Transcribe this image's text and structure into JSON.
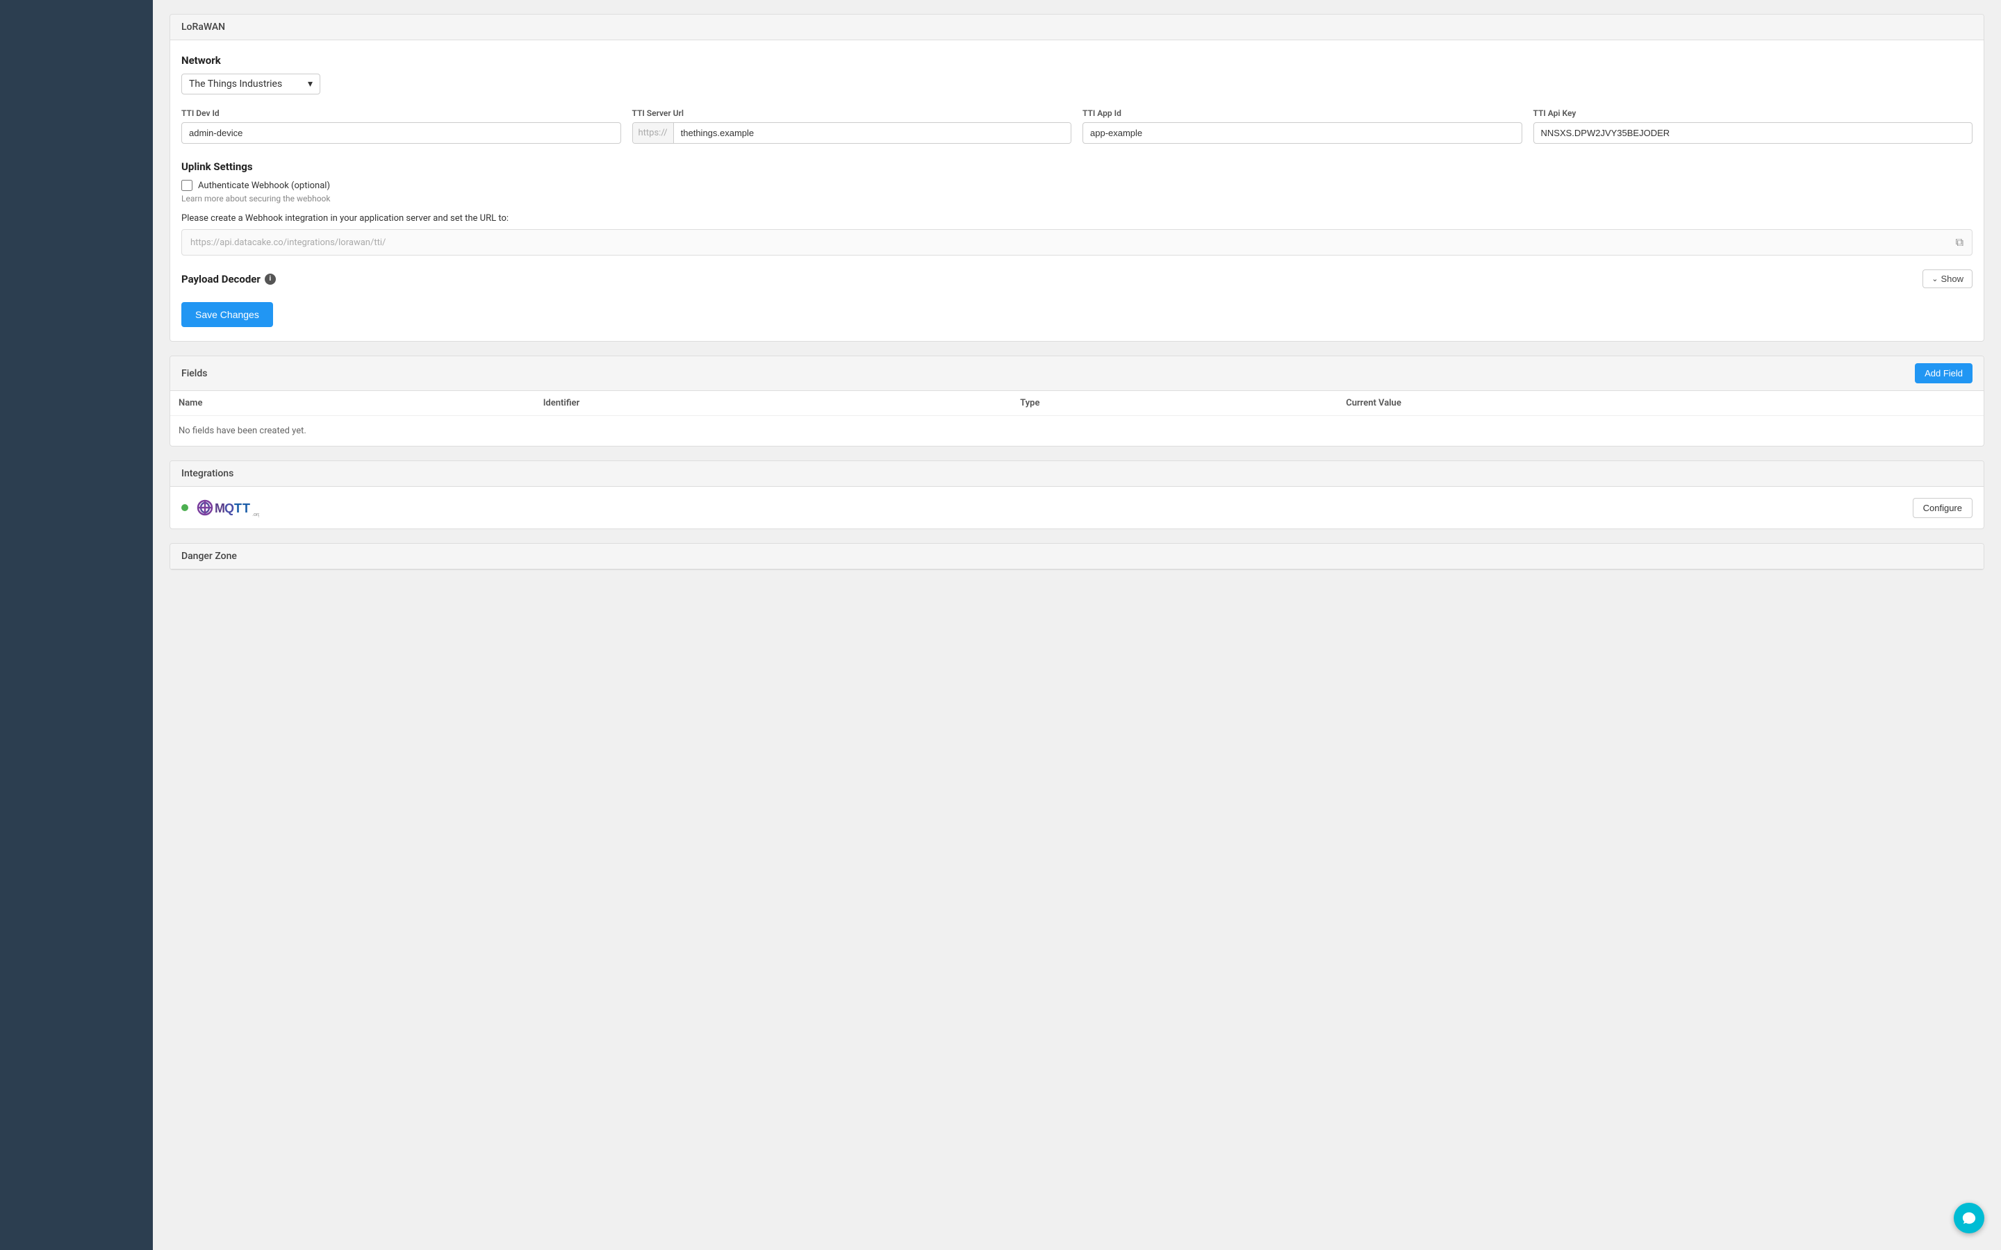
{
  "lorawan_section": {
    "header": "LoRaWAN",
    "network": {
      "label": "Network",
      "selected": "The Things Industries",
      "dropdown_icon": "▾"
    },
    "tti_dev_id": {
      "label": "TTI Dev Id",
      "value": "admin-device",
      "placeholder": ""
    },
    "tti_server_url": {
      "label": "TTI Server Url",
      "prefix": "https://",
      "value": "thethings.example",
      "placeholder": ""
    },
    "tti_app_id": {
      "label": "TTI App Id",
      "value": "app-example",
      "placeholder": ""
    },
    "tti_api_key": {
      "label": "TTI Api Key",
      "value": "NNSXS.DPW2JVY35BEJODER",
      "placeholder": ""
    },
    "uplink_settings": {
      "label": "Uplink Settings",
      "webhook_label": "Authenticate Webhook (optional)",
      "help_text": "Learn more about securing the webhook",
      "notice": "Please create a Webhook integration in your application server and set the URL to:",
      "webhook_url": "https://api.datacake.co/integrations/lorawan/tti/",
      "copy_icon": "⧉"
    },
    "payload_decoder": {
      "label": "Payload Decoder",
      "show_label": "Show"
    },
    "save_button": "Save Changes"
  },
  "fields_section": {
    "header": "Fields",
    "add_button": "Add Field",
    "columns": [
      "Name",
      "Identifier",
      "Type",
      "Current Value"
    ],
    "empty_message": "No fields have been created yet."
  },
  "integrations_section": {
    "header": "Integrations",
    "mqtt": {
      "status": "active",
      "configure_label": "Configure"
    }
  },
  "danger_zone": {
    "header": "Danger Zone"
  },
  "chat": {
    "icon_label": "chat"
  }
}
